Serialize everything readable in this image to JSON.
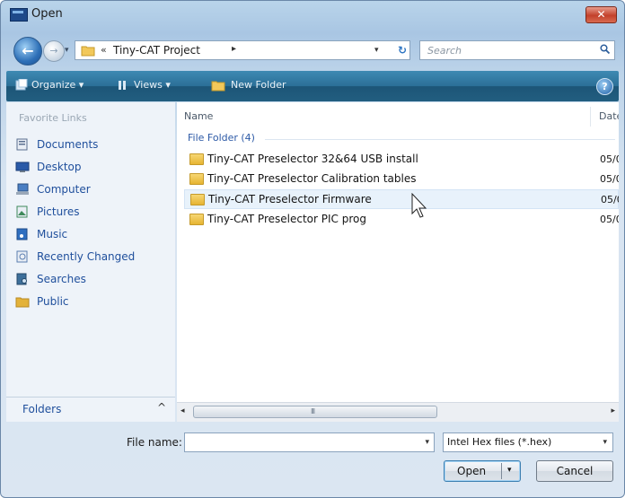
{
  "window": {
    "title": "Open",
    "close_glyph": "✕"
  },
  "address": {
    "recent_glyph": "▾",
    "chevron": "«",
    "path": "Tiny-CAT Project",
    "separator": "▸",
    "dropdown_glyph": "▾",
    "refresh_glyph": "↻"
  },
  "search": {
    "placeholder": "Search"
  },
  "toolbar": {
    "organize": "Organize ▾",
    "views": "Views ▾",
    "new_folder": "New Folder",
    "help_glyph": "?"
  },
  "sidebar": {
    "heading": "Favorite Links",
    "items": [
      {
        "label": "Documents",
        "icon": "documents-icon",
        "color": "#5a6f8f"
      },
      {
        "label": "Desktop",
        "icon": "desktop-icon",
        "color": "#2a5aa8"
      },
      {
        "label": "Computer",
        "icon": "computer-icon",
        "color": "#4a7fc3"
      },
      {
        "label": "Pictures",
        "icon": "pictures-icon",
        "color": "#3e8a5a"
      },
      {
        "label": "Music",
        "icon": "music-icon",
        "color": "#2f6fc0"
      },
      {
        "label": "Recently Changed",
        "icon": "recently-changed-icon",
        "color": "#5a7db0"
      },
      {
        "label": "Searches",
        "icon": "searches-icon",
        "color": "#3d6f9a"
      },
      {
        "label": "Public",
        "icon": "public-icon",
        "color": "#e3b23a"
      }
    ],
    "folders_label": "Folders",
    "folders_chevron": "^"
  },
  "filelist": {
    "columns": {
      "name": "Name",
      "date": "Date"
    },
    "group": "File Folder (4)",
    "rows": [
      {
        "name": "Tiny-CAT Preselector 32&64 USB install",
        "date": "05/0"
      },
      {
        "name": "Tiny-CAT Preselector Calibration tables",
        "date": "05/0"
      },
      {
        "name": "Tiny-CAT Preselector Firmware",
        "date": "05/0"
      },
      {
        "name": "Tiny-CAT Preselector PIC prog",
        "date": "05/0"
      }
    ],
    "hovered_row": 2
  },
  "scrollbar": {
    "left": "◂",
    "right": "▸",
    "grip": "III"
  },
  "bottom": {
    "filename_label": "File name:",
    "filename_value": "",
    "filename_drop": "▾",
    "filter_value": "Intel Hex files (*.hex)",
    "filter_drop": "▾",
    "open_label": "Open",
    "open_drop": "▾",
    "cancel_label": "Cancel"
  }
}
